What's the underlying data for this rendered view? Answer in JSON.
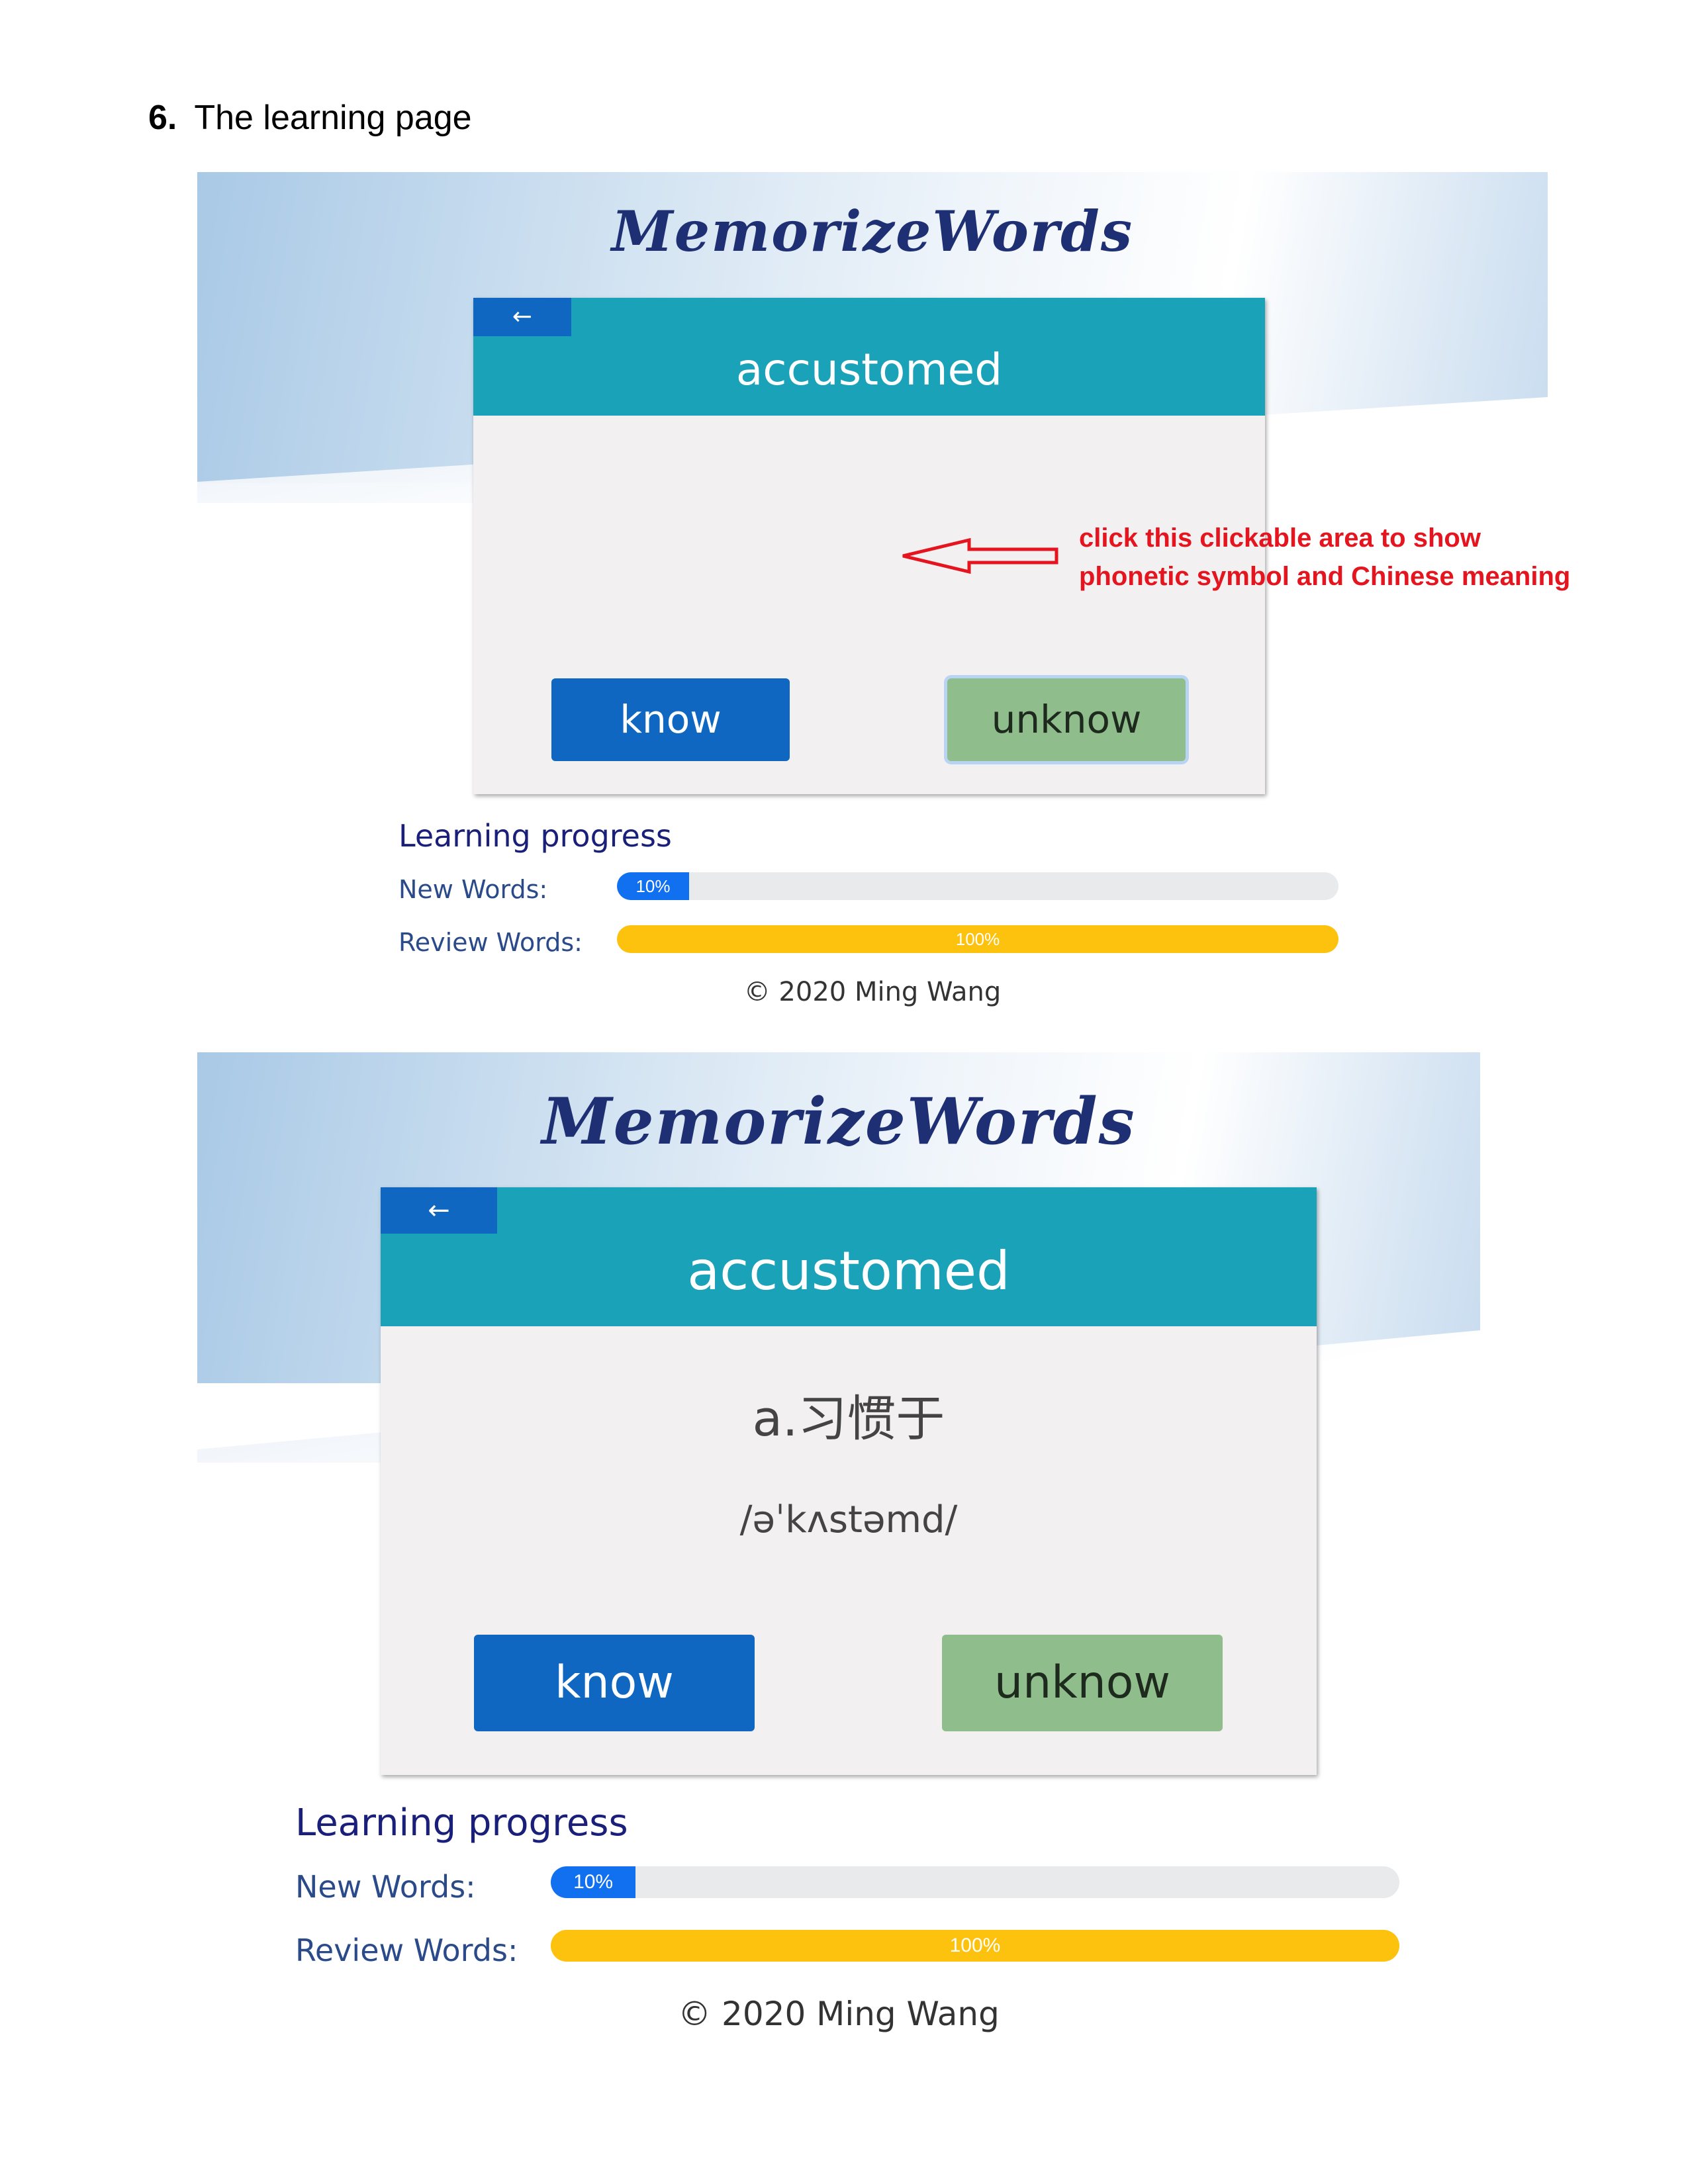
{
  "section": {
    "number": "6.",
    "title": "The learning page"
  },
  "screens": [
    {
      "logo": "MemorizeWords",
      "back_label": "←",
      "word": "accustomed",
      "meaning": "",
      "phonetic": "",
      "know_label": "know",
      "unknow_label": "unknow",
      "progress_title": "Learning progress",
      "new_label": "New Words:",
      "new_value": 0.1,
      "new_text": "10%",
      "review_label": "Review Words:",
      "review_value": 1.0,
      "review_text": "100%",
      "copyright": "© 2020 Ming Wang"
    },
    {
      "logo": "MemorizeWords",
      "back_label": "←",
      "word": "accustomed",
      "meaning": "a.习惯于",
      "phonetic": "/əˈkʌstəmd/",
      "know_label": "know",
      "unknow_label": "unknow",
      "progress_title": "Learning progress",
      "new_label": "New Words:",
      "new_value": 0.1,
      "new_text": "10%",
      "review_label": "Review Words:",
      "review_value": 1.0,
      "review_text": "100%",
      "copyright": "© 2020 Ming Wang"
    }
  ],
  "annotation": {
    "line1": "click this clickable area to show",
    "line2": "phonetic symbol and Chinese meaning"
  },
  "colors": {
    "header": "#1aa2b8",
    "know": "#0f67c2",
    "unknow": "#8fbd8c",
    "progress_new": "#1170f0",
    "progress_review": "#fcc20d",
    "annotation": "#e5151f"
  }
}
